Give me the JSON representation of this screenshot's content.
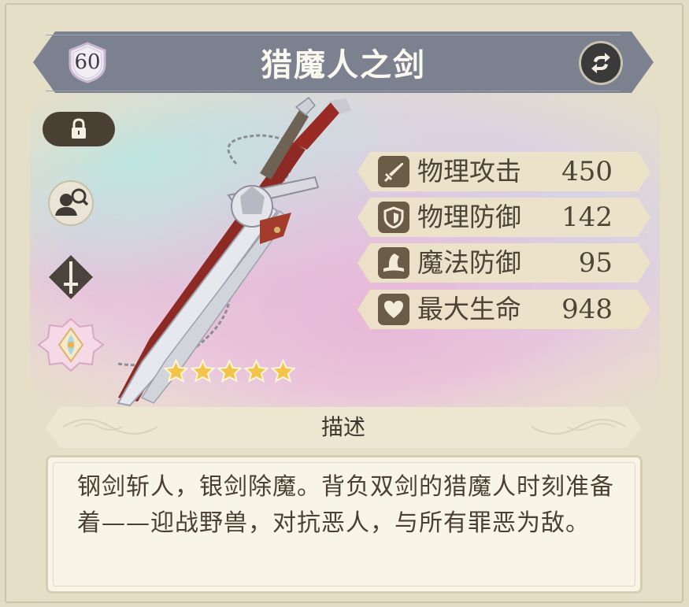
{
  "header": {
    "level": "60",
    "title": "猎魔人之剑"
  },
  "stars": {
    "count": 5,
    "max": 5
  },
  "stats": [
    {
      "label": "物理攻击",
      "value": "450",
      "icon": "sword-icon"
    },
    {
      "label": "物理防御",
      "value": "142",
      "icon": "shield-icon"
    },
    {
      "label": "魔法防御",
      "value": "95",
      "icon": "wizard-hat-icon"
    },
    {
      "label": "最大生命",
      "value": "948",
      "icon": "heart-icon"
    }
  ],
  "description": {
    "title": "描述",
    "text": "钢剑斩人，银剑除魔。背负双剑的猎魔人时刻准备着——迎战野兽，对抗恶人，与所有罪恶为敌。"
  },
  "colors": {
    "banner": "#7b818f",
    "stat_bg": "#ece3c7",
    "stat_icon_bg": "#6b5c47",
    "text_dark": "#4d4437",
    "star": "#f2c54a"
  }
}
